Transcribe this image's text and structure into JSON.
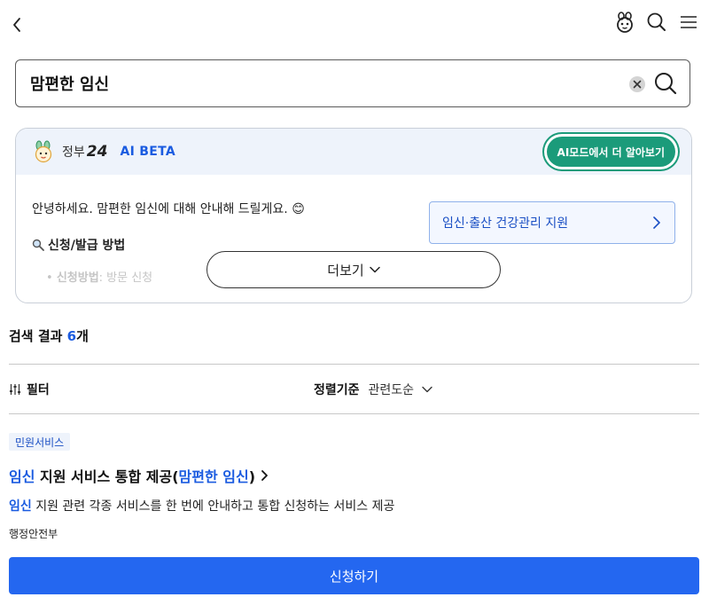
{
  "search": {
    "value": "맘편한 임신"
  },
  "ai_card": {
    "brand": "정부",
    "brand_num": "24",
    "beta": "AI BETA",
    "mode_button": "AI모드에서 더 알아보기",
    "greeting": "안녕하세요. 맘편한 임신에 대해 안내해 드릴게요. 😊",
    "section_title": "신청/발급 방법",
    "bullet_label": "신청방법",
    "bullet_value": ": 방문 신청",
    "related_link": "임신·출산 건강관리 지원",
    "more_button": "더보기"
  },
  "results": {
    "count_label": "검색 결과",
    "count": "6",
    "count_unit": "개",
    "filter_label": "필터",
    "sort_label": "정렬기준",
    "sort_value": "관련도순"
  },
  "item": {
    "badge": "민원서비스",
    "title_hl1": "임신",
    "title_mid": " 지원 서비스 통합 제공(",
    "title_hl2": "맘편한 임신",
    "title_end": ")",
    "desc_hl": "임신",
    "desc_rest": " 지원 관련 각종 서비스를 한 번에 안내하고 통합 신청하는 서비스 제공",
    "agency": "행정안전부",
    "apply_button": "신청하기"
  },
  "colors": {
    "accent": "#1a5be0",
    "apply": "#2467f0",
    "ai_mode": "#1b9b7a",
    "ai_header_bg": "#eef3fb"
  }
}
